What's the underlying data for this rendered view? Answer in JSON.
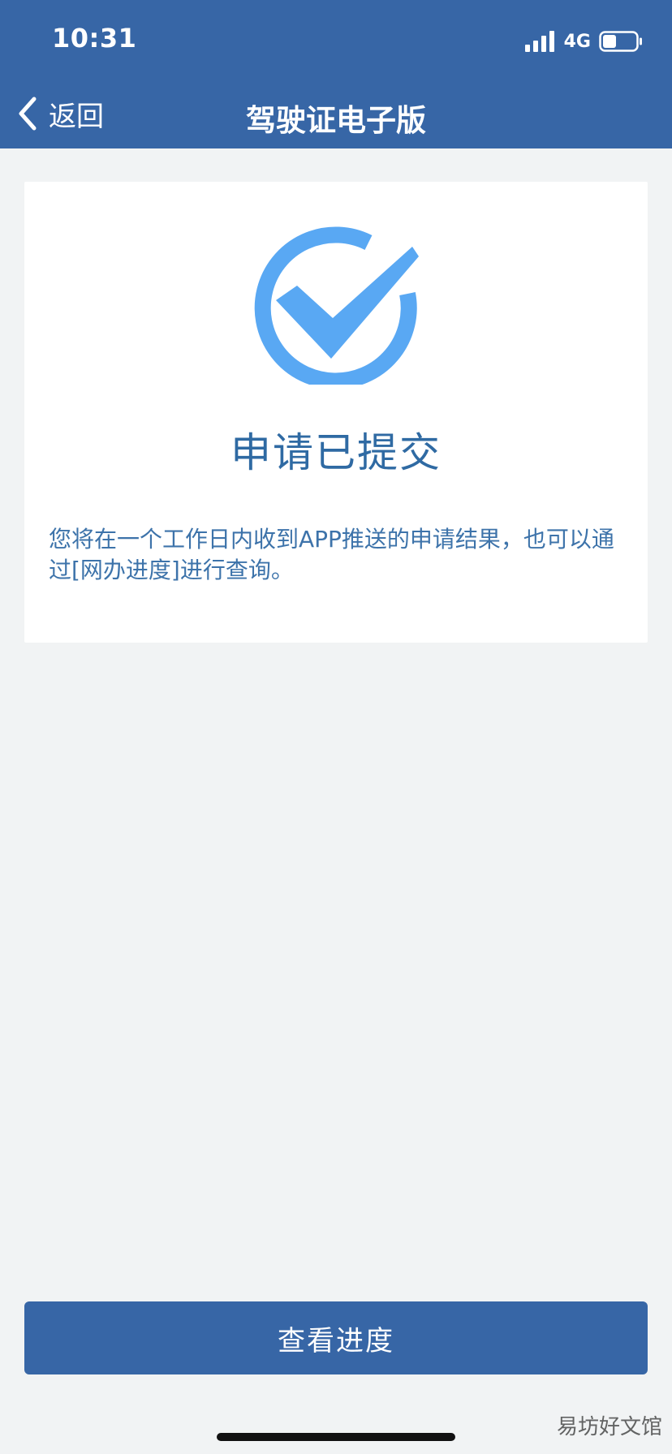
{
  "status_bar": {
    "time": "10:31",
    "network": "4G"
  },
  "nav": {
    "back_label": "返回",
    "title": "驾驶证电子版"
  },
  "result": {
    "title": "申请已提交",
    "message": "您将在一个工作日内收到APP推送的申请结果，也可以通过[网办进度]进行查询。"
  },
  "actions": {
    "view_progress_label": "查看进度"
  },
  "watermark": "易坊好文馆",
  "icons": {
    "success": "check-circle-icon",
    "back": "chevron-left-icon",
    "signal": "signal-bars-icon",
    "battery": "battery-icon"
  },
  "colors": {
    "header_bg": "#3766a6",
    "page_bg": "#f1f3f4",
    "accent": "#59a8f3",
    "title_text": "#2f6aa3"
  }
}
